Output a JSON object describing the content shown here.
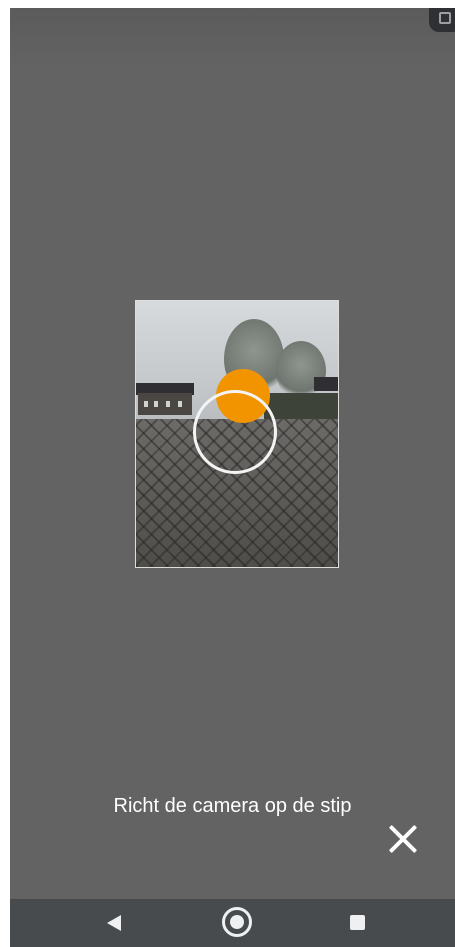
{
  "screen": {
    "instruction": "Richt de camera op de stip"
  },
  "colors": {
    "background": "#636363",
    "dot": "#f29400",
    "ring": "#f4f4f4",
    "nav_bar": "#474b4e"
  },
  "icons": {
    "close": "close-icon",
    "back": "back-icon",
    "home": "home-icon",
    "recent": "recent-apps-icon"
  }
}
